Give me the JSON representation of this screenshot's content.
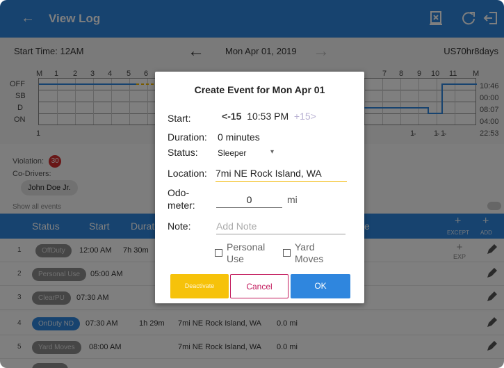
{
  "appbar": {
    "title": "View Log"
  },
  "date_row": {
    "start_time": "Start Time: 12AM",
    "date": "Mon Apr 01, 2019",
    "cycle": "US70hr8days"
  },
  "graph": {
    "hours": [
      "M",
      "1",
      "2",
      "3",
      "4",
      "5",
      "6",
      "7",
      "8",
      "9",
      "10",
      "11",
      "M"
    ],
    "row_labels": [
      "OFF",
      "SB",
      "D",
      "ON"
    ],
    "totals": [
      "10:46",
      "00:00",
      "08:07",
      "04:00",
      "22:53"
    ],
    "bottom_left": "1",
    "bottom_ticks": [
      "1̴",
      "1̴",
      "1̴"
    ]
  },
  "violation": {
    "label": "Violation:",
    "count": "30"
  },
  "co_drivers": {
    "label": "Co-Drivers:",
    "name": "John Doe Jr."
  },
  "show_all": "Show all events",
  "table": {
    "headers": {
      "status": "Status",
      "start": "Start",
      "duration": "Durat",
      "remark": "e"
    },
    "except_label": "EXCEPT",
    "add_label": "ADD",
    "rows": [
      {
        "num": "1",
        "status": "OffDuty",
        "start": "12:00 AM",
        "duration": "7h 30m",
        "location": "",
        "odometer": "",
        "exp": "EXP"
      },
      {
        "num": "2",
        "status": "Personal Use",
        "start": "05:00 AM",
        "duration": "",
        "location": "",
        "odometer": ""
      },
      {
        "num": "3",
        "status": "ClearPU",
        "start": "07:30 AM",
        "duration": "",
        "location": "",
        "odometer": ""
      },
      {
        "num": "4",
        "status": "OnDuty ND",
        "start": "07:30 AM",
        "duration": "1h 29m",
        "location": "7mi NE Rock Island, WA",
        "odometer": "0.0 mi"
      },
      {
        "num": "5",
        "status": "Yard Moves",
        "start": "08:00 AM",
        "duration": "",
        "location": "7mi NE Rock Island, WA",
        "odometer": "0.0 mi"
      }
    ]
  },
  "dialog": {
    "title": "Create Event for Mon Apr 01",
    "start_label": "Start:",
    "minus": "-15",
    "start_time": "10:53 PM",
    "plus": "+15",
    "duration_label": "Duration:",
    "duration_value": "0 minutes",
    "status_label": "Status:",
    "status_value": "Sleeper",
    "location_label": "Location:",
    "location_value": "7mi NE Rock Island, WA",
    "odometer_label_1": "Odo-",
    "odometer_label_2": "meter:",
    "odometer_value": "0",
    "odometer_unit": "mi",
    "note_label": "Note:",
    "note_placeholder": "Add Note",
    "personal_use_1": "Personal",
    "personal_use_2": "Use",
    "yard_moves_1": "Yard",
    "yard_moves_2": "Moves",
    "deactivate": "Deactivate",
    "cancel": "Cancel",
    "ok": "OK"
  },
  "colors": {
    "primary": "#2f86de",
    "accent": "#f6c20a",
    "cancel": "#c2185b",
    "violation": "#d32f2f"
  }
}
